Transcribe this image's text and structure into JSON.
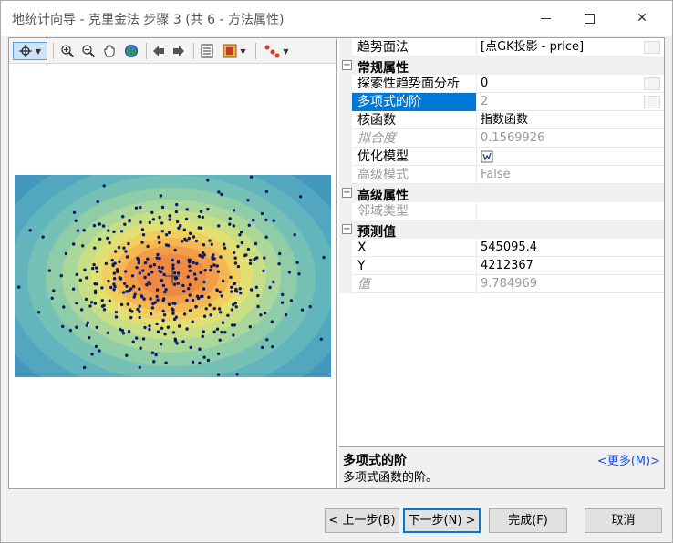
{
  "window": {
    "title": "地统计向导 - 克里金法 步骤 3 (共 6 - 方法属性)",
    "minimize_glyph": "—",
    "close_glyph": "✕"
  },
  "toolbar": {
    "icons": [
      "select-icon",
      "zoom-in-icon",
      "zoom-out-icon",
      "pan-icon",
      "full-extent-icon",
      "back-icon",
      "forward-icon",
      "table-icon",
      "layer-icon",
      "points-icon"
    ]
  },
  "properties": {
    "top_row": {
      "name": "趋势面法",
      "value": "[点GK投影 - price]"
    },
    "categories": [
      {
        "label": "常规属性",
        "toggle": "−",
        "rows": [
          {
            "name": "探索性趋势面分析",
            "value": "0"
          },
          {
            "name": "多项式的阶",
            "value": "2"
          },
          {
            "name": "核函数",
            "value": "指数函数"
          },
          {
            "name": "拟合度",
            "value": "0.1569926"
          },
          {
            "name": "优化模型",
            "value": ""
          },
          {
            "name": "高级模式",
            "value": "False"
          }
        ]
      },
      {
        "label": "高级属性",
        "toggle": "−",
        "rows": [
          {
            "name": "邻域类型",
            "value": ""
          }
        ]
      },
      {
        "label": "预测值",
        "toggle": "−",
        "rows": [
          {
            "name": "X",
            "value": "545095.4"
          },
          {
            "name": "Y",
            "value": "4212367"
          },
          {
            "name": "值",
            "value": "9.784969"
          }
        ]
      }
    ]
  },
  "description": {
    "title": "多项式的阶",
    "text": "多项式函数的阶。",
    "more_link": "<更多(M)>"
  },
  "buttons": {
    "prev": "< 上一步(B)",
    "next": "下一步(N) >",
    "finish": "完成(F)",
    "cancel": "取消"
  },
  "colors": {
    "selection": "#0078d7",
    "link": "#1a4fd6",
    "point": "#0b1a66"
  }
}
